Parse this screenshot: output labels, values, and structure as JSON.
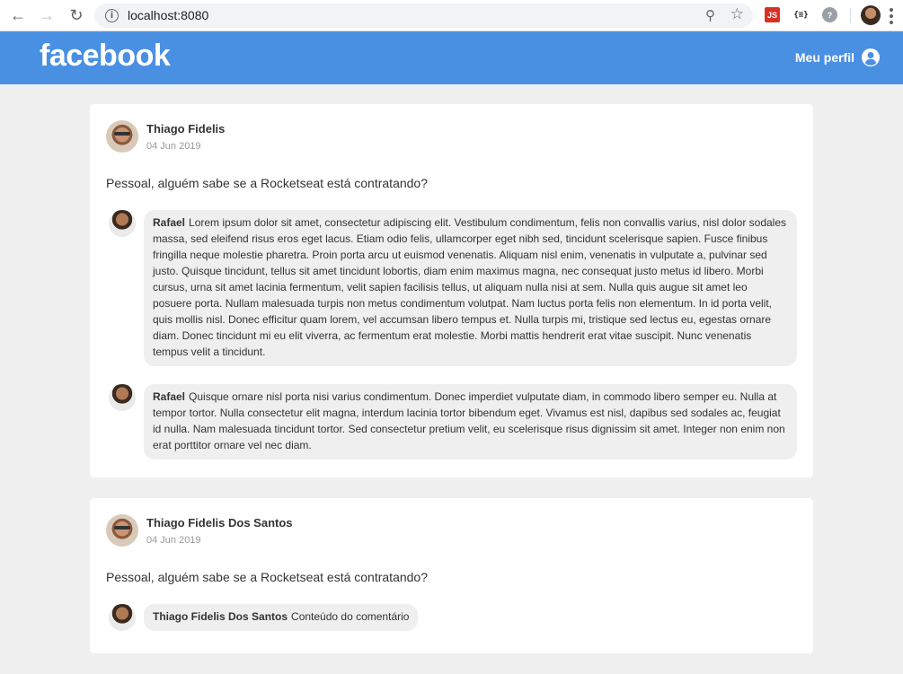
{
  "browser": {
    "url": "localhost:8080"
  },
  "header": {
    "logo": "facebook",
    "profile_label": "Meu perfil"
  },
  "posts": [
    {
      "author": "Thiago Fidelis",
      "date": "04 Jun 2019",
      "content": "Pessoal, alguém sabe se a Rocketseat está contratando?",
      "comments": [
        {
          "author": "Rafael",
          "text": "Lorem ipsum dolor sit amet, consectetur adipiscing elit. Vestibulum condimentum, felis non convallis varius, nisl dolor sodales massa, sed eleifend risus eros eget lacus. Etiam odio felis, ullamcorper eget nibh sed, tincidunt scelerisque sapien. Fusce finibus fringilla neque molestie pharetra. Proin porta arcu ut euismod venenatis. Aliquam nisl enim, venenatis in vulputate a, pulvinar sed justo. Quisque tincidunt, tellus sit amet tincidunt lobortis, diam enim maximus magna, nec consequat justo metus id libero. Morbi cursus, urna sit amet lacinia fermentum, velit sapien facilisis tellus, ut aliquam nulla nisi at sem. Nulla quis augue sit amet leo posuere porta. Nullam malesuada turpis non metus condimentum volutpat. Nam luctus porta felis non elementum. In id porta velit, quis mollis nisl. Donec efficitur quam lorem, vel accumsan libero tempus et. Nulla turpis mi, tristique sed lectus eu, egestas ornare diam. Donec tincidunt mi eu elit viverra, ac fermentum erat molestie. Morbi mattis hendrerit erat vitae suscipit. Nunc venenatis tempus velit a tincidunt."
        },
        {
          "author": "Rafael",
          "text": "Quisque ornare nisl porta nisi varius condimentum. Donec imperdiet vulputate diam, in commodo libero semper eu. Nulla at tempor tortor. Nulla consectetur elit magna, interdum lacinia tortor bibendum eget. Vivamus est nisl, dapibus sed sodales ac, feugiat id nulla. Nam malesuada tincidunt tortor. Sed consectetur pretium velit, eu scelerisque risus dignissim sit amet. Integer non enim non erat porttitor ornare vel nec diam."
        }
      ]
    },
    {
      "author": "Thiago Fidelis Dos Santos",
      "date": "04 Jun 2019",
      "content": "Pessoal, alguém sabe se a Rocketseat está contratando?",
      "comments": [
        {
          "author": "Thiago Fidelis Dos Santos",
          "text": "Conteúdo do comentário"
        }
      ]
    }
  ]
}
